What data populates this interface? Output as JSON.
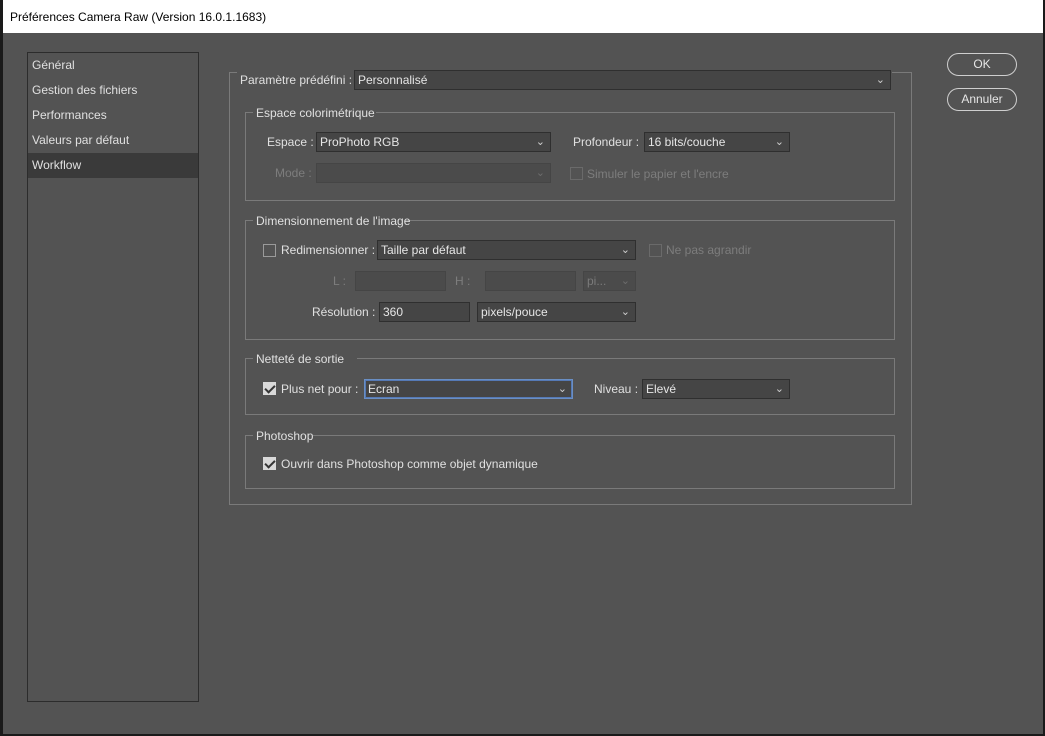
{
  "window": {
    "title": "Préférences Camera Raw  (Version 16.0.1.1683)"
  },
  "sidebar": {
    "items": [
      {
        "label": "Général"
      },
      {
        "label": "Gestion des fichiers"
      },
      {
        "label": "Performances"
      },
      {
        "label": "Valeurs par défaut"
      },
      {
        "label": "Workflow",
        "active": true
      }
    ]
  },
  "preset": {
    "label": "Paramètre prédéfini :",
    "value": "Personnalisé"
  },
  "color_space": {
    "legend": "Espace colorimétrique",
    "space_label": "Espace :",
    "space_value": "ProPhoto RGB",
    "depth_label": "Profondeur :",
    "depth_value": "16 bits/couche",
    "mode_label": "Mode :",
    "mode_value": "",
    "simulate_label": "Simuler le papier et l'encre"
  },
  "sizing": {
    "legend": "Dimensionnement de l'image",
    "resize_label": "Redimensionner :",
    "resize_value": "Taille par défaut",
    "no_enlarge_label": "Ne pas agrandir",
    "w_label": "L :",
    "h_label": "H :",
    "unit_value": "pi...",
    "resolution_label": "Résolution :",
    "resolution_value": "360",
    "resolution_unit": "pixels/pouce"
  },
  "sharpen": {
    "legend": "Netteté de sortie",
    "for_label": "Plus net pour :",
    "for_value": "Ecran",
    "level_label": "Niveau :",
    "level_value": "Elevé"
  },
  "photoshop": {
    "legend": "Photoshop",
    "smart_object_label": "Ouvrir dans Photoshop comme objet dynamique"
  },
  "buttons": {
    "ok": "OK",
    "cancel": "Annuler"
  },
  "icons": {
    "dropdown": "chevron-down-icon",
    "checkmark": "checkmark-icon"
  }
}
